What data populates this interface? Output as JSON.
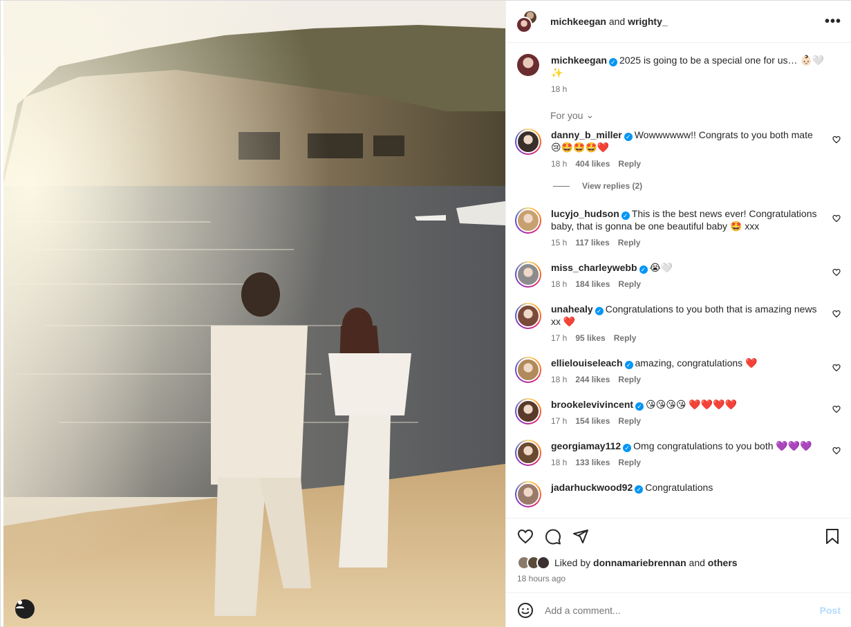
{
  "header": {
    "user1": "michkeegan",
    "and": "and",
    "user2": "wrighty_",
    "more": "•••"
  },
  "caption": {
    "username": "michkeegan",
    "text": "2025 is going to be a special one for us… 👶🏻🤍✨",
    "time": "18 h"
  },
  "for_you": "For you",
  "comments": [
    {
      "username": "danny_b_miller",
      "text": "Wowwwwww!! Congrats to you both mate 😢🤩🤩🤩❤️",
      "time": "18 h",
      "likes": "404 likes",
      "reply": "Reply",
      "view_replies": "View replies (2)",
      "avatar_color": "#3a2f2a"
    },
    {
      "username": "lucyjo_hudson",
      "text": "This is the best news ever! Congratulations baby, that is gonna be one beautiful baby 🤩 xxx",
      "time": "15 h",
      "likes": "117 likes",
      "reply": "Reply",
      "avatar_color": "#c8a070"
    },
    {
      "username": "miss_charleywebb",
      "text": "😭🤍",
      "time": "18 h",
      "likes": "184 likes",
      "reply": "Reply",
      "avatar_color": "#8c8c8c"
    },
    {
      "username": "unahealy",
      "text": "Congratulations to you both that is amazing news xx ❤️",
      "time": "17 h",
      "likes": "95 likes",
      "reply": "Reply",
      "avatar_color": "#7a4a3a"
    },
    {
      "username": "ellielouiseleach",
      "text": "amazing, congratulations ❤️",
      "time": "18 h",
      "likes": "244 likes",
      "reply": "Reply",
      "avatar_color": "#b08a5a"
    },
    {
      "username": "brookelevivincent",
      "text": "😘😘😘😘 ❤️❤️❤️❤️",
      "time": "17 h",
      "likes": "154 likes",
      "reply": "Reply",
      "avatar_color": "#5a3a2a"
    },
    {
      "username": "georgiamay112",
      "text": "Omg congratulations to you both 💜💜💜",
      "time": "18 h",
      "likes": "133 likes",
      "reply": "Reply",
      "avatar_color": "#6a4a30"
    },
    {
      "username": "jadarhuckwood92",
      "text": "Congratulations",
      "time": "",
      "likes": "",
      "reply": "",
      "avatar_color": "#9a7a6a"
    }
  ],
  "actions": {
    "liked_by_prefix": "Liked by",
    "liked_by_user": "donnamariebrennan",
    "liked_by_and": "and",
    "liked_by_others": "others",
    "time_ago": "18 hours ago"
  },
  "add_comment": {
    "placeholder": "Add a comment...",
    "post": "Post"
  },
  "colors": {
    "link_blue": "#0095f6",
    "muted": "#737373",
    "post_disabled": "#b3dbff"
  }
}
